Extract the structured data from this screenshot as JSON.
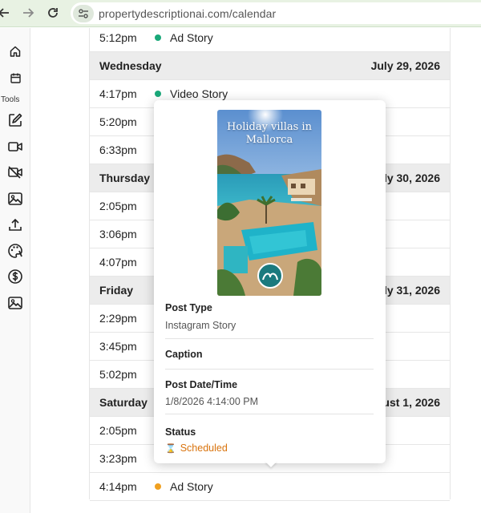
{
  "browser": {
    "back_icon": "arrow-left-icon",
    "forward_icon": "arrow-right-icon",
    "reload_icon": "reload-icon",
    "site_info_icon": "tune-icon",
    "url": "propertydescriptionai.com/calendar"
  },
  "sidebar": {
    "tools_label": "Tools",
    "icons": [
      "home-icon",
      "calendar-icon",
      "edit-icon",
      "video-icon",
      "video-off-icon",
      "image-icon",
      "upload-icon",
      "palette-icon",
      "dollar-icon",
      "image-icon"
    ]
  },
  "calendar": {
    "rows": [
      {
        "kind": "event",
        "time": "5:12pm",
        "name": "Ad Story",
        "dot": "#1aa879"
      },
      {
        "kind": "day",
        "day": "Wednesday",
        "date": "July 29, 2026"
      },
      {
        "kind": "event",
        "time": "4:17pm",
        "name": "Video Story",
        "dot": "#1aa879"
      },
      {
        "kind": "event",
        "time": "5:20pm",
        "name": "",
        "dot": ""
      },
      {
        "kind": "event",
        "time": "6:33pm",
        "name": "",
        "dot": ""
      },
      {
        "kind": "day",
        "day": "Thursday",
        "date": "ly 30, 2026"
      },
      {
        "kind": "event",
        "time": "2:05pm",
        "name": "",
        "dot": ""
      },
      {
        "kind": "event",
        "time": "3:06pm",
        "name": "",
        "dot": ""
      },
      {
        "kind": "event",
        "time": "4:07pm",
        "name": "",
        "dot": ""
      },
      {
        "kind": "day",
        "day": "Friday",
        "date": "ly 31, 2026"
      },
      {
        "kind": "event",
        "time": "2:29pm",
        "name": "",
        "dot": ""
      },
      {
        "kind": "event",
        "time": "3:45pm",
        "name": "",
        "dot": ""
      },
      {
        "kind": "event",
        "time": "5:02pm",
        "name": "",
        "dot": ""
      },
      {
        "kind": "day",
        "day": "Saturday",
        "date": "ust 1, 2026"
      },
      {
        "kind": "event",
        "time": "2:05pm",
        "name": "",
        "dot": ""
      },
      {
        "kind": "event",
        "time": "3:23pm",
        "name": "",
        "dot": ""
      },
      {
        "kind": "event",
        "time": "4:14pm",
        "name": "Ad Story",
        "dot": "#f0a020"
      }
    ]
  },
  "popup": {
    "image_title": "Holiday villas in Mallorca",
    "post_type_label": "Post Type",
    "post_type_value": "Instagram Story",
    "caption_label": "Caption",
    "post_datetime_label": "Post Date/Time",
    "post_datetime_value": "1/8/2026 4:14:00 PM",
    "status_label": "Status",
    "status_icon": "⌛",
    "status_value": "Scheduled",
    "status_color": "#d9730d"
  }
}
